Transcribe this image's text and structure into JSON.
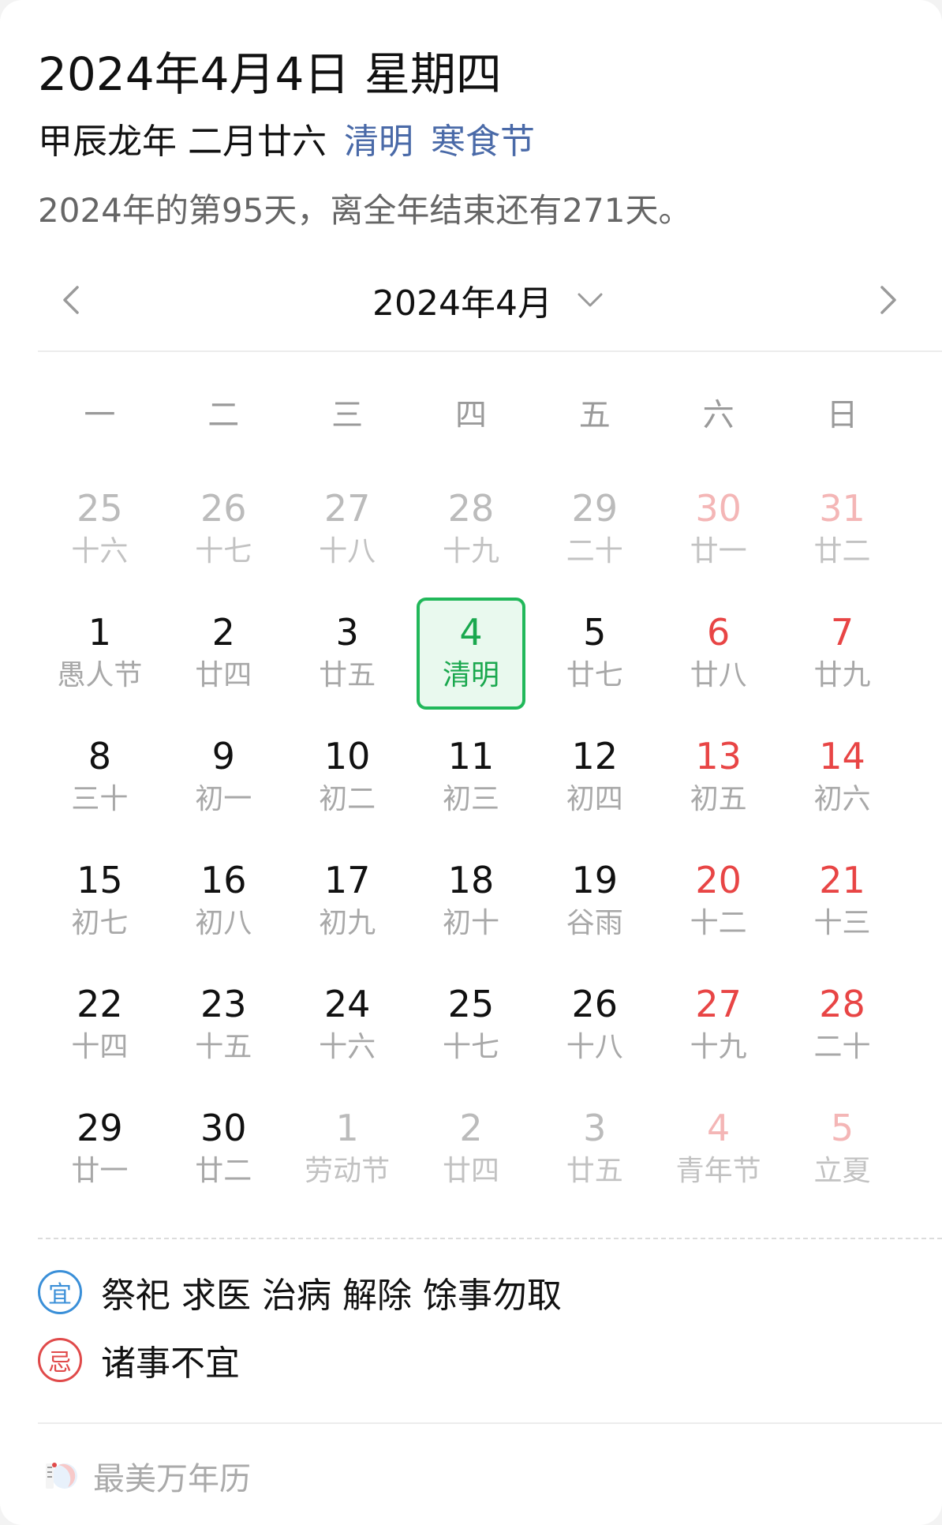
{
  "header": {
    "date_title": "2024年4月4日 星期四",
    "lunar": "甲辰龙年 二月廿六",
    "solar_term": "清明",
    "festival": "寒食节",
    "year_progress": "2024年的第95天，离全年结束还有271天。"
  },
  "nav": {
    "month_label": "2024年4月",
    "prev_icon": "chevron-left-icon",
    "next_icon": "chevron-right-icon",
    "dropdown_icon": "chevron-down-icon"
  },
  "weekdays": [
    "一",
    "二",
    "三",
    "四",
    "五",
    "六",
    "日"
  ],
  "weeks": [
    [
      {
        "num": "25",
        "sub": "十六",
        "state": "dim"
      },
      {
        "num": "26",
        "sub": "十七",
        "state": "dim"
      },
      {
        "num": "27",
        "sub": "十八",
        "state": "dim"
      },
      {
        "num": "28",
        "sub": "十九",
        "state": "dim"
      },
      {
        "num": "29",
        "sub": "二十",
        "state": "dim"
      },
      {
        "num": "30",
        "sub": "廿一",
        "state": "dim-weekend"
      },
      {
        "num": "31",
        "sub": "廿二",
        "state": "dim-weekend"
      }
    ],
    [
      {
        "num": "1",
        "sub": "愚人节",
        "state": "normal"
      },
      {
        "num": "2",
        "sub": "廿四",
        "state": "normal"
      },
      {
        "num": "3",
        "sub": "廿五",
        "state": "normal"
      },
      {
        "num": "4",
        "sub": "清明",
        "state": "today"
      },
      {
        "num": "5",
        "sub": "廿七",
        "state": "normal"
      },
      {
        "num": "6",
        "sub": "廿八",
        "state": "weekend"
      },
      {
        "num": "7",
        "sub": "廿九",
        "state": "weekend"
      }
    ],
    [
      {
        "num": "8",
        "sub": "三十",
        "state": "normal"
      },
      {
        "num": "9",
        "sub": "初一",
        "state": "normal"
      },
      {
        "num": "10",
        "sub": "初二",
        "state": "normal"
      },
      {
        "num": "11",
        "sub": "初三",
        "state": "normal"
      },
      {
        "num": "12",
        "sub": "初四",
        "state": "normal"
      },
      {
        "num": "13",
        "sub": "初五",
        "state": "weekend"
      },
      {
        "num": "14",
        "sub": "初六",
        "state": "weekend"
      }
    ],
    [
      {
        "num": "15",
        "sub": "初七",
        "state": "normal"
      },
      {
        "num": "16",
        "sub": "初八",
        "state": "normal"
      },
      {
        "num": "17",
        "sub": "初九",
        "state": "normal"
      },
      {
        "num": "18",
        "sub": "初十",
        "state": "normal"
      },
      {
        "num": "19",
        "sub": "谷雨",
        "state": "normal"
      },
      {
        "num": "20",
        "sub": "十二",
        "state": "weekend"
      },
      {
        "num": "21",
        "sub": "十三",
        "state": "weekend"
      }
    ],
    [
      {
        "num": "22",
        "sub": "十四",
        "state": "normal"
      },
      {
        "num": "23",
        "sub": "十五",
        "state": "normal"
      },
      {
        "num": "24",
        "sub": "十六",
        "state": "normal"
      },
      {
        "num": "25",
        "sub": "十七",
        "state": "normal"
      },
      {
        "num": "26",
        "sub": "十八",
        "state": "normal"
      },
      {
        "num": "27",
        "sub": "十九",
        "state": "weekend"
      },
      {
        "num": "28",
        "sub": "二十",
        "state": "weekend"
      }
    ],
    [
      {
        "num": "29",
        "sub": "廿一",
        "state": "normal"
      },
      {
        "num": "30",
        "sub": "廿二",
        "state": "normal"
      },
      {
        "num": "1",
        "sub": "劳动节",
        "state": "dim"
      },
      {
        "num": "2",
        "sub": "廿四",
        "state": "dim"
      },
      {
        "num": "3",
        "sub": "廿五",
        "state": "dim"
      },
      {
        "num": "4",
        "sub": "青年节",
        "state": "dim-weekend"
      },
      {
        "num": "5",
        "sub": "立夏",
        "state": "dim-weekend"
      }
    ]
  ],
  "almanac": {
    "yi_label": "宜",
    "yi_text": "祭祀 求医 治病 解除 馀事勿取",
    "ji_label": "忌",
    "ji_text": "诸事不宜"
  },
  "footer": {
    "brand": "最美万年历",
    "logo_icon": "app-logo-icon"
  },
  "colors": {
    "weekend": "#e84545",
    "today_border": "#21b85a",
    "today_bg": "#e9f9ee",
    "term_link": "#4a6aa8",
    "yi": "#3a8fd8",
    "ji": "#e04a4a"
  }
}
